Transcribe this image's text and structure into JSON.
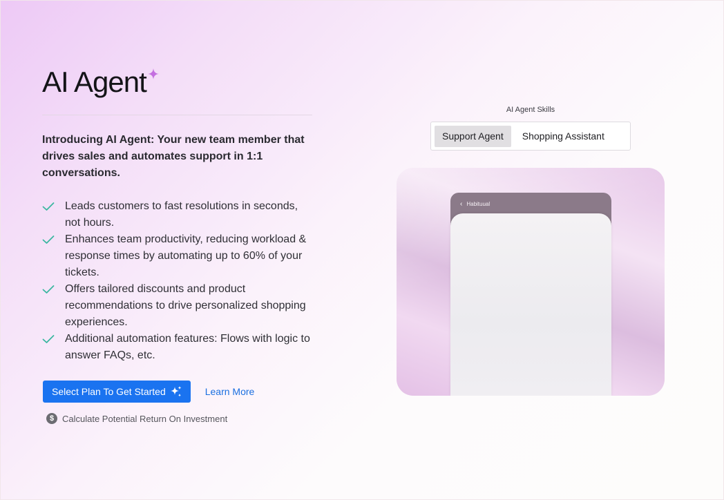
{
  "hero": {
    "title": "AI Agent",
    "intro": "Introducing AI Agent: Your new team member that drives sales and automates support in 1:1 conversations.",
    "features": [
      "Leads customers to fast resolutions in seconds, not hours.",
      "Enhances team productivity, reducing workload & response times by automating up to 60% of your tickets.",
      "Offers tailored discounts and product recommendations to drive personalized shopping experiences.",
      "Additional automation features: Flows with logic to answer FAQs, etc."
    ],
    "primary_cta": "Select Plan To Get Started",
    "secondary_cta": "Learn More",
    "roi_link": "Calculate Potential Return On Investment"
  },
  "skills": {
    "label": "AI Agent Skills",
    "tabs": [
      "Support Agent",
      "Shopping Assistant"
    ],
    "active_tab": "Support Agent"
  },
  "preview": {
    "header_title": "Habituual"
  },
  "colors": {
    "accent": "#1a73f0",
    "check": "#3ab7a0",
    "sparkle": "#c46fe0"
  }
}
